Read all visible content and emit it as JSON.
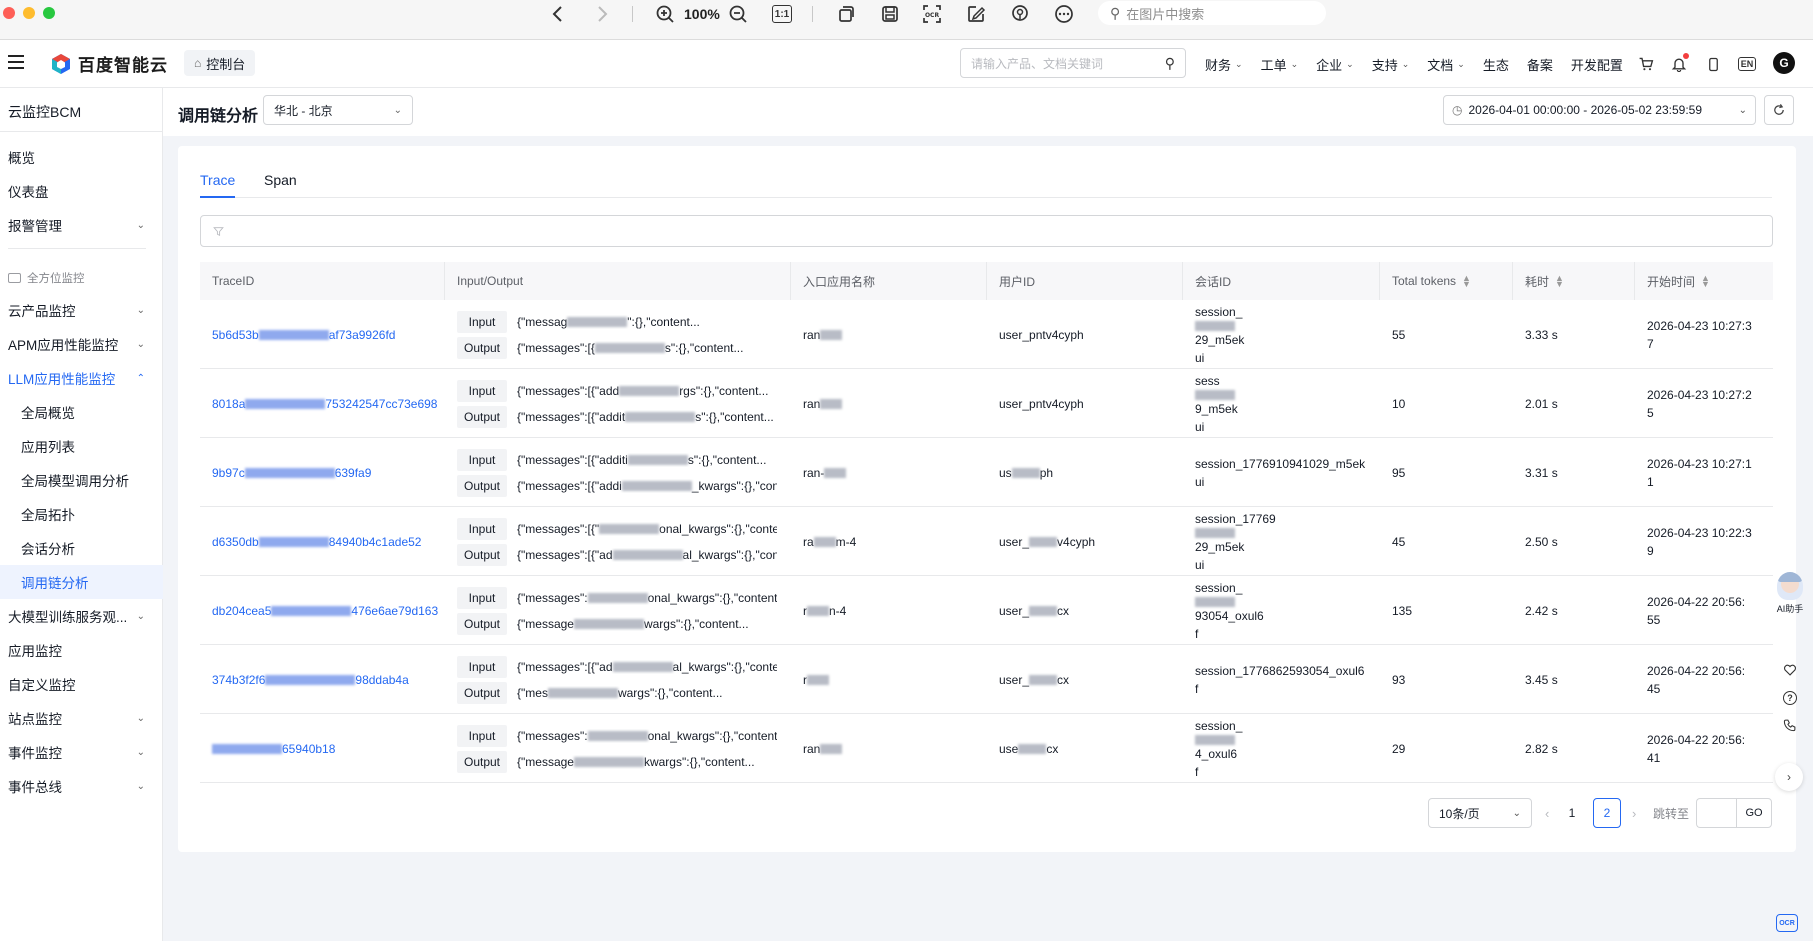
{
  "viewer": {
    "zoom": "100%",
    "fit_label": "1:1",
    "search_placeholder": "在图片中搜索"
  },
  "header": {
    "brand": "百度智能云",
    "console": "控制台",
    "search_placeholder": "请输入产品、文档关键词",
    "nav": [
      {
        "label": "财务",
        "dropdown": true
      },
      {
        "label": "工单",
        "dropdown": true
      },
      {
        "label": "企业",
        "dropdown": true
      },
      {
        "label": "支持",
        "dropdown": true
      },
      {
        "label": "文档",
        "dropdown": true
      },
      {
        "label": "生态",
        "dropdown": false
      },
      {
        "label": "备案",
        "dropdown": false
      },
      {
        "label": "开发配置",
        "dropdown": false
      }
    ],
    "lang": "EN",
    "avatar": "G"
  },
  "sidebar": {
    "title": "云监控BCM",
    "items": [
      {
        "label": "概览"
      },
      {
        "label": "仪表盘"
      },
      {
        "label": "报警管理",
        "expandable": true
      }
    ],
    "section": "全方位监控",
    "groups": [
      {
        "label": "云产品监控",
        "expandable": true
      },
      {
        "label": "APM应用性能监控",
        "expandable": true
      },
      {
        "label": "LLM应用性能监控",
        "expandable": true,
        "expanded": true
      }
    ],
    "llm_children": [
      {
        "label": "全局概览"
      },
      {
        "label": "应用列表"
      },
      {
        "label": "全局模型调用分析"
      },
      {
        "label": "全局拓扑"
      },
      {
        "label": "会话分析"
      },
      {
        "label": "调用链分析",
        "active": true
      }
    ],
    "tail": [
      {
        "label": "大模型训练服务观...",
        "expandable": true
      },
      {
        "label": "应用监控",
        "expandable": false
      },
      {
        "label": "自定义监控",
        "expandable": false
      },
      {
        "label": "站点监控",
        "expandable": true
      },
      {
        "label": "事件监控",
        "expandable": true
      },
      {
        "label": "事件总线",
        "expandable": true
      }
    ]
  },
  "page": {
    "title": "调用链分析",
    "region": "华北 - 北京",
    "time_range": "2026-04-01 00:00:00 - 2026-05-02 23:59:59"
  },
  "tabs": [
    {
      "label": "Trace",
      "active": true
    },
    {
      "label": "Span",
      "active": false
    }
  ],
  "table": {
    "columns": [
      "TraceID",
      "Input/Output",
      "入口应用名称",
      "用户ID",
      "会话ID",
      "Total tokens",
      "耗时",
      "开始时间"
    ],
    "io_labels": {
      "input": "Input",
      "output": "Output"
    },
    "rows": [
      {
        "trace_a": "5b6d53b",
        "trace_b": "af73a9926fd",
        "input_a": "{\"messag",
        "input_b": "\":{},\"content...",
        "output_a": "{\"messages\":[{",
        "output_b": "s\":{},\"content...",
        "app": "ran",
        "user": "user_pntv4cyph",
        "session_a": "session_",
        "session_b": "29_m5ek",
        "session_c": "ui",
        "tokens": "55",
        "duration": "3.33 s",
        "start_a": "2026-04-23 10:27:3",
        "start_b": "7"
      },
      {
        "trace_a": "8018a",
        "trace_b": "753242547cc73e698",
        "input_a": "{\"messages\":[{\"add",
        "input_b": "rgs\":{},\"content...",
        "output_a": "{\"messages\":[{\"addit",
        "output_b": "s\":{},\"content...",
        "app": "ran",
        "user": "user_pntv4cyph",
        "session_a": "sess",
        "session_b": "9_m5ek",
        "session_c": "ui",
        "tokens": "10",
        "duration": "2.01 s",
        "start_a": "2026-04-23 10:27:2",
        "start_b": "5"
      },
      {
        "trace_a": "9b97c",
        "trace_b": "639fa9",
        "input_a": "{\"messages\":[{\"additi",
        "input_b": "s\":{},\"content...",
        "output_a": "{\"messages\":[{\"addi",
        "output_b": "_kwargs\":{},\"content...",
        "app": "ran-",
        "user": "us",
        "session_a": "session_1776910941029_m5ek",
        "session_b": "",
        "session_c": "ui",
        "tokens": "95",
        "duration": "3.31 s",
        "start_a": "2026-04-23 10:27:1",
        "start_b": "1",
        "user_b": "ph"
      },
      {
        "trace_a": "d6350db",
        "trace_b": "84940b4c1ade52",
        "input_a": "{\"messages\":[{\"",
        "input_b": "onal_kwargs\":{},\"content...",
        "output_a": "{\"messages\":[{\"ad",
        "output_b": "al_kwargs\":{},\"content...",
        "app": "ra",
        "app_b": "m-4",
        "user": "user_",
        "user_b": "v4cyph",
        "session_a": "session_17769",
        "session_b": "29_m5ek",
        "session_c": "ui",
        "tokens": "45",
        "duration": "2.50 s",
        "start_a": "2026-04-23 10:22:3",
        "start_b": "9"
      },
      {
        "trace_a": "db204cea5",
        "trace_b": "476e6ae79d163",
        "input_a": "{\"messages\":",
        "input_b": "onal_kwargs\":{},\"content...",
        "output_a": "{\"message",
        "output_b": "wargs\":{},\"content...",
        "app": "r",
        "app_b": "n-4",
        "user": "user_",
        "user_b": "cx",
        "session_a": "session_",
        "session_b": "93054_oxul6",
        "session_c": "f",
        "tokens": "135",
        "duration": "2.42 s",
        "start_a": "2026-04-22 20:56:",
        "start_b": "55"
      },
      {
        "trace_a": "374b3f2f6",
        "trace_b": "98ddab4a",
        "input_a": "{\"messages\":[{\"ad",
        "input_b": "al_kwargs\":{},\"content...",
        "output_a": "{\"mes",
        "output_b": "wargs\":{},\"content...",
        "app": "r",
        "user": "user_",
        "user_b": "cx",
        "session_a": "session_1776862593054_oxul6",
        "session_b": "",
        "session_c": "f",
        "tokens": "93",
        "duration": "3.45 s",
        "start_a": "2026-04-22 20:56:",
        "start_b": "45"
      },
      {
        "trace_a": "",
        "trace_b": "65940b18",
        "input_a": "{\"messages\":",
        "input_b": "onal_kwargs\":{},\"content...",
        "output_a": "{\"message",
        "output_b": "kwargs\":{},\"content...",
        "app": "ran",
        "user": "use",
        "user_b": "cx",
        "session_a": "session_",
        "session_b": "4_oxul6",
        "session_c": "f",
        "tokens": "29",
        "duration": "2.82 s",
        "start_a": "2026-04-22 20:56:",
        "start_b": "41"
      }
    ]
  },
  "pagination": {
    "page_size": "10条/页",
    "pages": [
      "1",
      "2"
    ],
    "current": "2",
    "jump_label": "跳转至",
    "go": "GO"
  },
  "assistant": {
    "label": "AI助手"
  },
  "icons": {
    "search": "search-icon",
    "cart": "cart-icon",
    "bell": "bell-icon",
    "clock": "clock-icon",
    "refresh": "refresh-icon"
  },
  "colors": {
    "accent": "#2468f2",
    "bell_dot": "#f33e3e"
  }
}
